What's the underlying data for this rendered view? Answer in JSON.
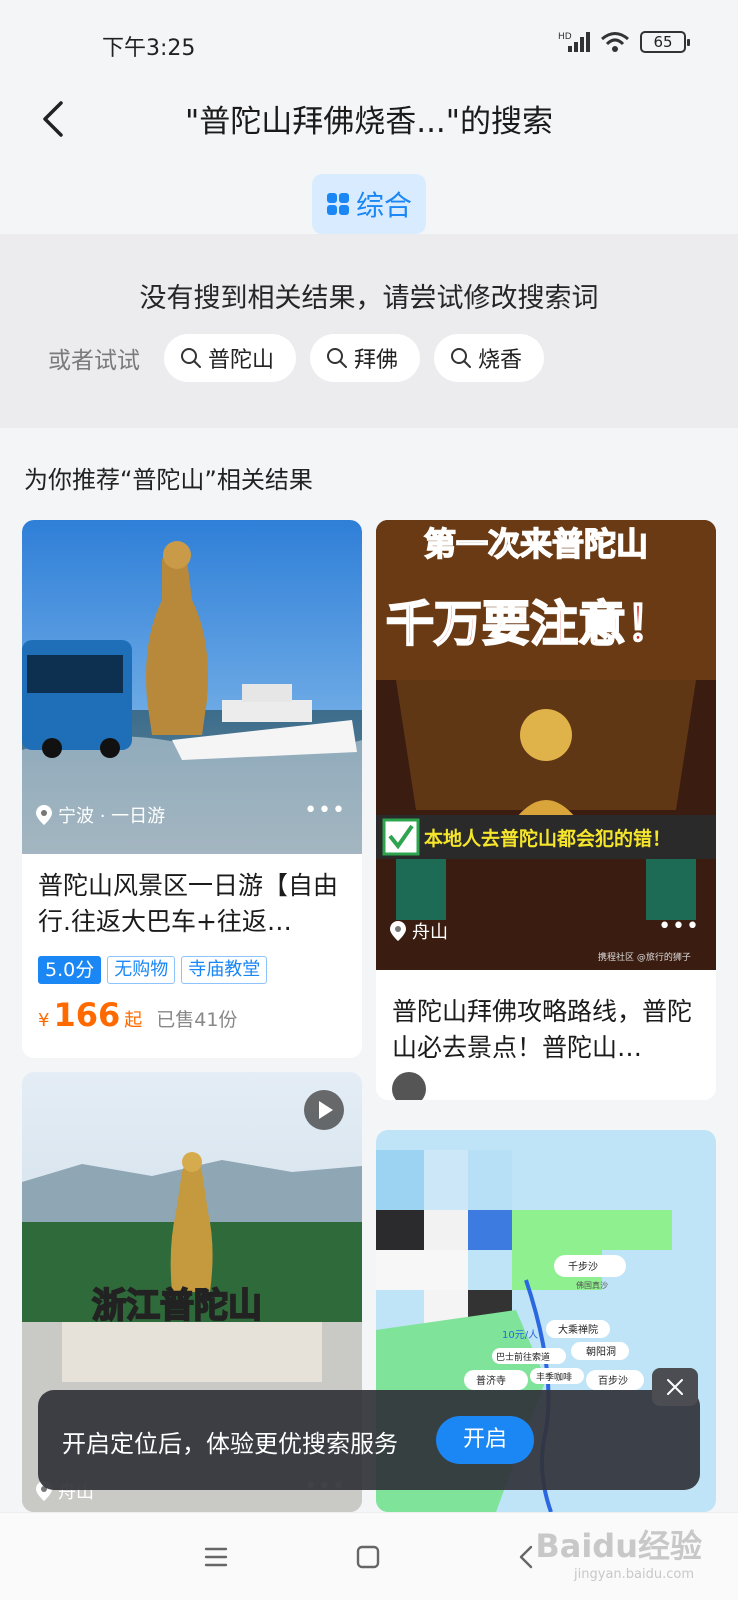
{
  "status": {
    "time": "下午3:25",
    "battery": "65",
    "network": "HD"
  },
  "header": {
    "title": "\"普陀山拜佛烧香...\"的搜索",
    "tab_all": "综合"
  },
  "no_result": {
    "message": "没有搜到相关结果，请尝试修改搜索词",
    "try_label": "或者试试",
    "suggestions": [
      "普陀山",
      "拜佛",
      "烧香"
    ]
  },
  "recommend": {
    "title": "为你推荐“普陀山”相关结果",
    "cards": [
      {
        "location": "宁波 · 一日游",
        "title": "普陀山风景区一日游【自由行.往返大巴车+往返…",
        "score": "5.0分",
        "tags": [
          "无购物",
          "寺庙教堂"
        ],
        "price_currency": "¥",
        "price": "166",
        "price_unit": "起",
        "sold": "已售41份"
      },
      {
        "location": "舟山",
        "image_headline": "第一次来普陀山",
        "image_warning": "千万要注意！",
        "image_banner": "本地人去普陀山都会犯的错！",
        "image_credit": "携程社区 @旅行的狮子",
        "title": "普陀山拜佛攻略路线，普陀山必去景点！普陀山…"
      },
      {
        "location": "舟山",
        "image_caption": "浙江普陀山"
      },
      {
        "map_labels": [
          "千步沙",
          "佛国真沙",
          "大乘禅院",
          "朝阳洞",
          "10元/人",
          "巴士前往索道",
          "普济寺",
          "丰季咖啡",
          "百步沙"
        ]
      }
    ]
  },
  "toast": {
    "message": "开启定位后，体验更优搜索服务",
    "button": "开启"
  },
  "watermark": {
    "brand": "Baidu经验",
    "url": "jingyan.baidu.com"
  }
}
